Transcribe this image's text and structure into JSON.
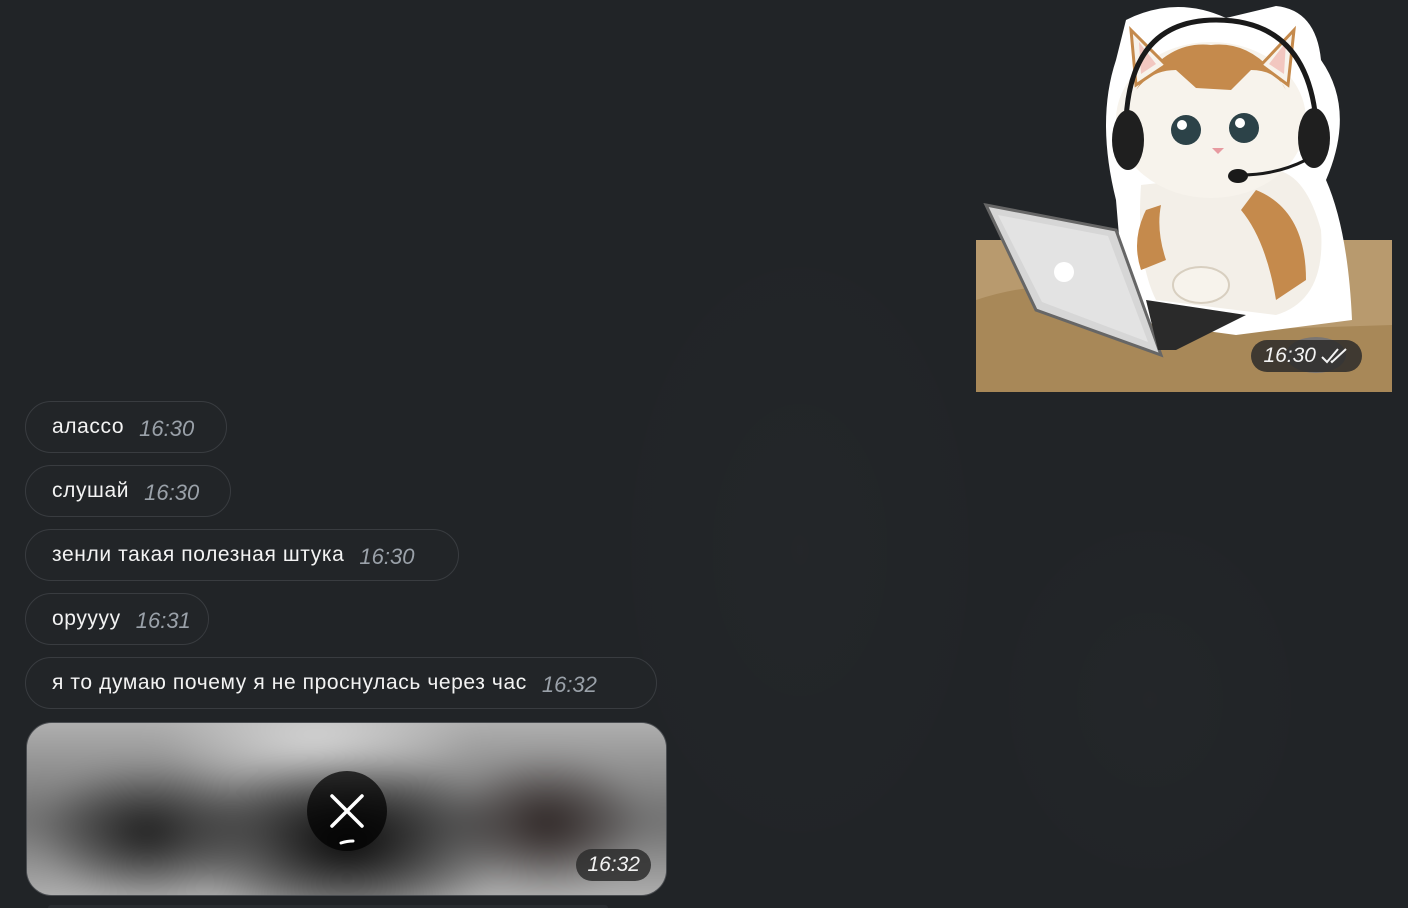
{
  "colors": {
    "background": "#212427",
    "bubble": "#222528",
    "bubble_border": "#393c40",
    "text": "#f3f3f3",
    "timestamp": "#9aa1a9"
  },
  "sticker": {
    "description_icon": "cat-with-headset-laptop-sticker",
    "time": "16:30",
    "status_icon": "double-check-icon"
  },
  "messages": [
    {
      "text": "алассо",
      "time": "16:30"
    },
    {
      "text": "слушай",
      "time": "16:30"
    },
    {
      "text": "зенли такая полезная штука",
      "time": "16:30"
    },
    {
      "text": "оруууу",
      "time": "16:31"
    },
    {
      "text": "я то думаю почему я не проснулась через час",
      "time": "16:32"
    }
  ],
  "media": {
    "time": "16:32",
    "cancel_icon": "close-icon"
  }
}
